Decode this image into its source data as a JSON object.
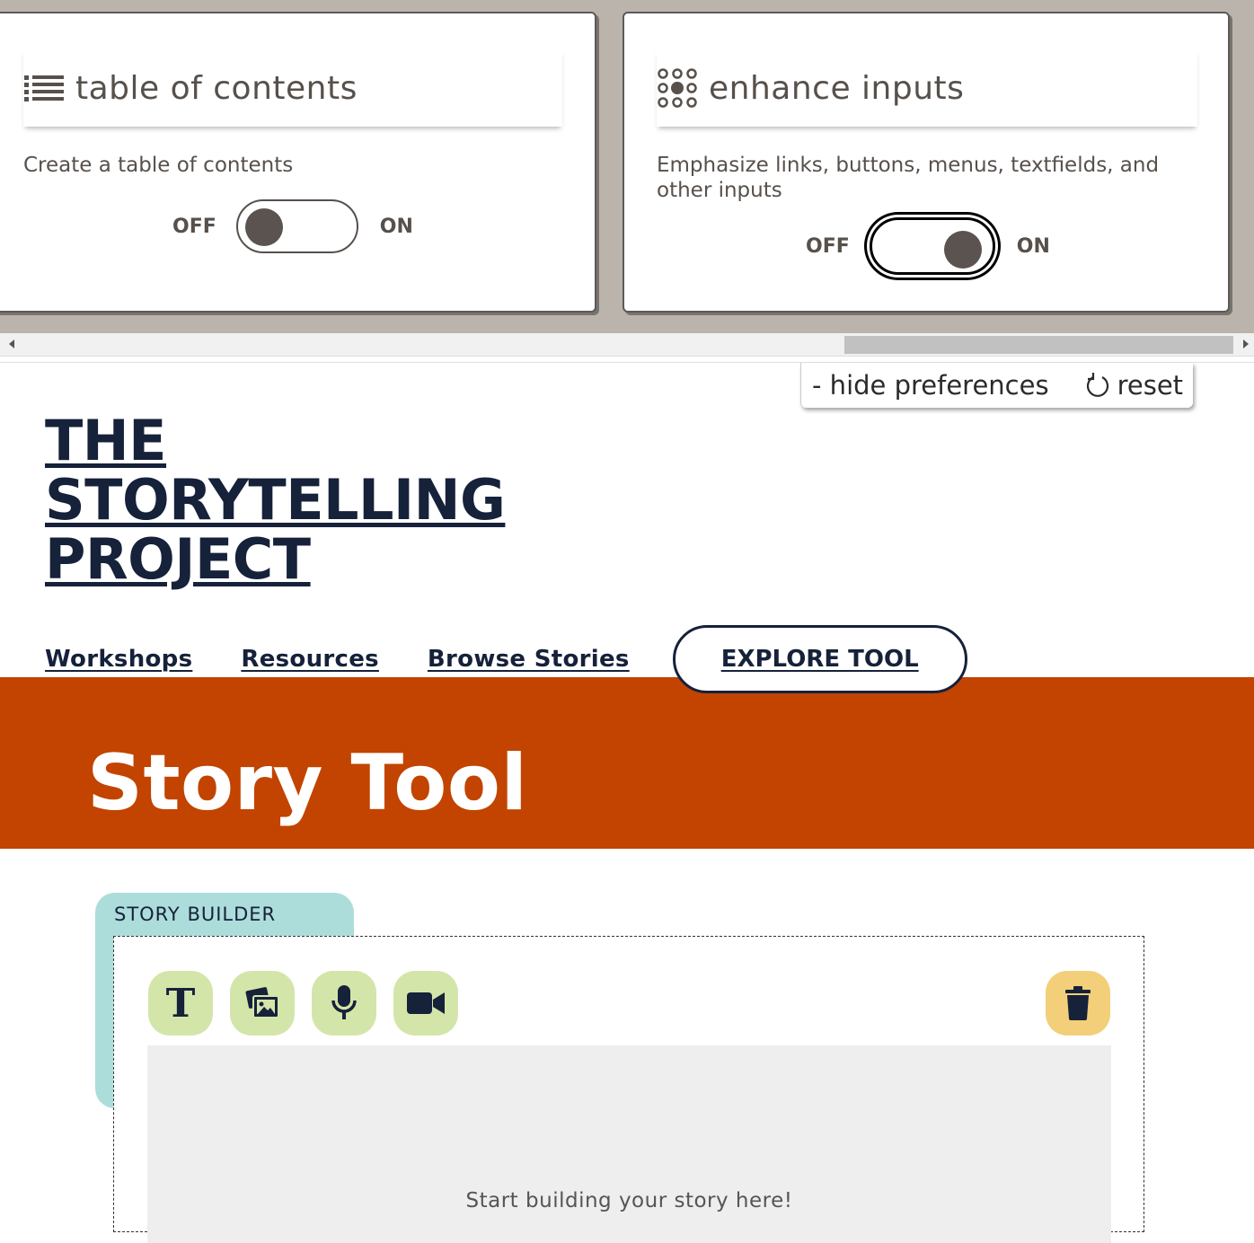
{
  "preferences": {
    "cards": [
      {
        "title": "table of contents",
        "icon": "list-icon",
        "description": "Create a table of contents",
        "off_label": "OFF",
        "on_label": "ON",
        "state": "off"
      },
      {
        "title": "enhance inputs",
        "icon": "dots-grid-icon",
        "description": "Emphasize links, buttons, menus, textfields, and other inputs",
        "off_label": "OFF",
        "on_label": "ON",
        "state": "on"
      }
    ],
    "hide_label": "- hide preferences",
    "reset_label": "reset"
  },
  "site": {
    "logo_lines": [
      "THE",
      "STORYTELLING",
      "PROJECT"
    ],
    "nav": [
      "Workshops",
      "Resources",
      "Browse Stories"
    ],
    "cta_label": "EXPLORE TOOL"
  },
  "hero": {
    "title": "Story Tool",
    "color": "#c24400"
  },
  "builder": {
    "tab_label": "STORY BUILDER",
    "tools": [
      {
        "name": "text",
        "icon": "text-icon",
        "glyph": "T"
      },
      {
        "name": "image",
        "icon": "image-icon"
      },
      {
        "name": "audio",
        "icon": "microphone-icon"
      },
      {
        "name": "video",
        "icon": "video-camera-icon"
      }
    ],
    "delete_icon": "trash-icon",
    "placeholder": "Start building your story here!"
  }
}
